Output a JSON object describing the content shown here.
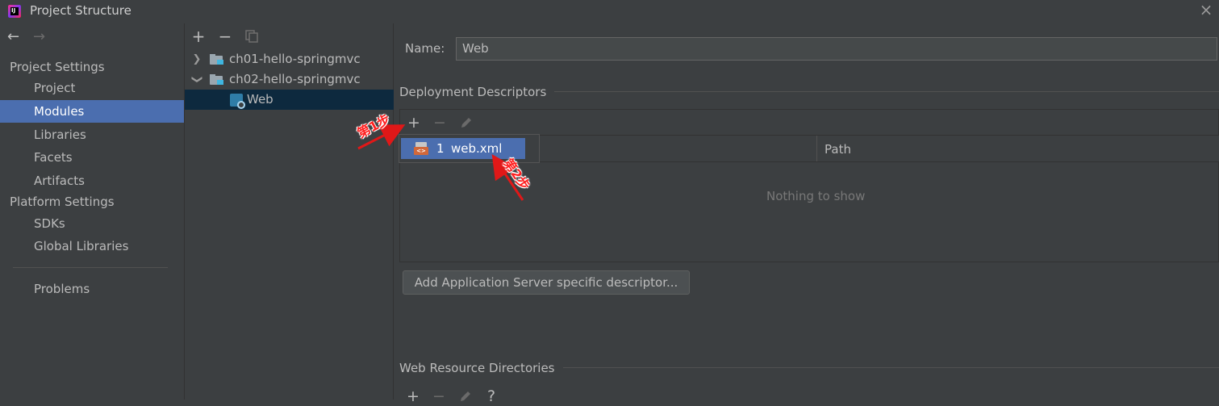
{
  "window": {
    "title": "Project Structure",
    "close_icon": "×"
  },
  "nav": {
    "back_icon": "←",
    "forward_icon": "→"
  },
  "sidebar": {
    "project_settings_header": "Project Settings",
    "project_items": [
      {
        "label": "Project"
      },
      {
        "label": "Modules",
        "selected": true
      },
      {
        "label": "Libraries"
      },
      {
        "label": "Facets"
      },
      {
        "label": "Artifacts"
      }
    ],
    "platform_settings_header": "Platform Settings",
    "platform_items": [
      {
        "label": "SDKs"
      },
      {
        "label": "Global Libraries"
      }
    ],
    "problems_label": "Problems"
  },
  "tree": {
    "toolbar": {
      "add": "+",
      "remove": "−"
    },
    "items": [
      {
        "label": "ch01-hello-springmvc",
        "expanded": false
      },
      {
        "label": "ch02-hello-springmvc",
        "expanded": true
      },
      {
        "label": "Web",
        "selected": true
      }
    ]
  },
  "details": {
    "name_label": "Name:",
    "name_value": "Web",
    "deployment_title": "Deployment Descriptors",
    "toolbar": {
      "add": "+",
      "remove": "−"
    },
    "column_path": "Path",
    "empty_text": "Nothing to show",
    "add_server_descriptor_button": "Add Application Server specific descriptor...",
    "web_resource_title": "Web Resource Directories",
    "web_resource_toolbar": {
      "add": "+",
      "remove": "−",
      "help": "?"
    }
  },
  "popup": {
    "items": [
      {
        "index": "1",
        "label": "web.xml"
      }
    ]
  },
  "annotations": {
    "step1": "第1步",
    "step2": "第2步"
  },
  "colors": {
    "background": "#3c3f41",
    "selection": "#4b6eaf",
    "tree_selection": "#0d293e",
    "annotation": "#ff2020"
  }
}
